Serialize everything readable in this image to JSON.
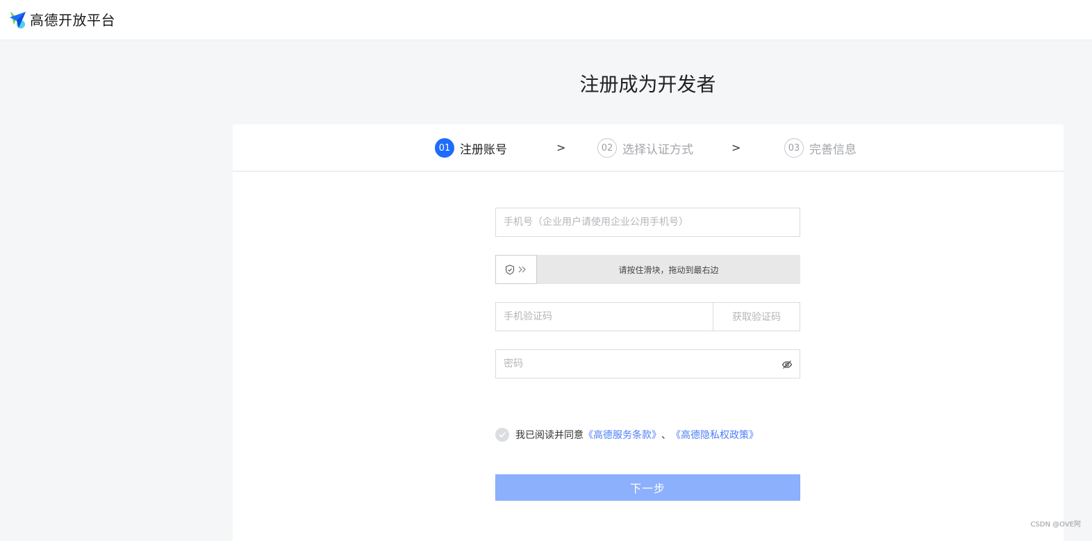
{
  "header": {
    "logo_text": "高德开放平台",
    "logo_icon": "amap-plane-logo-icon"
  },
  "page": {
    "title": "注册成为开发者"
  },
  "steps": [
    {
      "number": "01",
      "label": "注册账号",
      "active": true
    },
    {
      "number": "02",
      "label": "选择认证方式",
      "active": false
    },
    {
      "number": "03",
      "label": "完善信息",
      "active": false
    }
  ],
  "step_separator": ">",
  "form": {
    "phone_placeholder": "手机号（企业用户请使用企业公用手机号）",
    "slider_text": "请按住滑块，拖动到最右边",
    "code_placeholder": "手机验证码",
    "get_code_label": "获取验证码",
    "password_placeholder": "密码",
    "agree_prefix": "我已阅读并同意",
    "terms_link": "《高德服务条款》",
    "separator": "、",
    "privacy_link": "《高德隐私权政策》",
    "next_label": "下一步"
  },
  "colors": {
    "primary": "#1d6cfb",
    "button_disabled": "#8cb0fc",
    "link": "#4d7ef7"
  },
  "watermark": "CSDN @OVE阿"
}
